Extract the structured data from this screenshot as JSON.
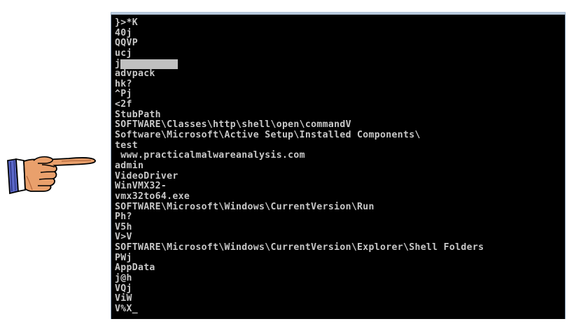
{
  "console": {
    "lines": [
      "}>*K",
      "40j",
      "QQVP",
      "ucj",
      "j",
      "advpack",
      "hk?",
      "^Pj",
      "<2f",
      "StubPath",
      "SOFTWARE\\Classes\\http\\shell\\open\\commandV",
      "Software\\Microsoft\\Active Setup\\Installed Components\\",
      "test",
      " www.practicalmalwareanalysis.com",
      "admin",
      "VideoDriver",
      "WinVMX32-",
      "vmx32to64.exe",
      "SOFTWARE\\Microsoft\\Windows\\CurrentVersion\\Run",
      "Ph?",
      "V5h",
      "V>V",
      "SOFTWARE\\Microsoft\\Windows\\CurrentVersion\\Explorer\\Shell Folders",
      "PWj",
      "AppData",
      "j@h",
      "VQj",
      "ViW",
      "V%X_"
    ]
  },
  "annotation": {
    "icon": "pointing-hand-icon",
    "points_to_line": 13
  }
}
